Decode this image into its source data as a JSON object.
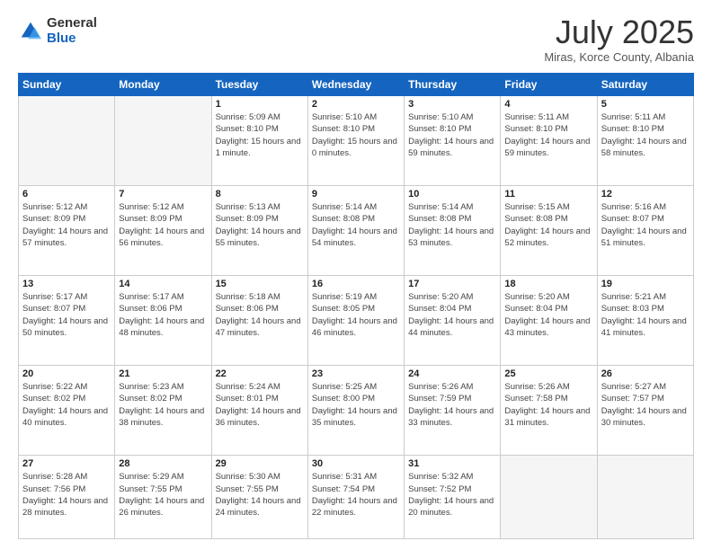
{
  "header": {
    "logo": {
      "general": "General",
      "blue": "Blue"
    },
    "title": "July 2025",
    "subtitle": "Miras, Korce County, Albania"
  },
  "weekdays": [
    "Sunday",
    "Monday",
    "Tuesday",
    "Wednesday",
    "Thursday",
    "Friday",
    "Saturday"
  ],
  "weeks": [
    [
      {
        "day": "",
        "info": ""
      },
      {
        "day": "",
        "info": ""
      },
      {
        "day": "1",
        "sunrise": "5:09 AM",
        "sunset": "8:10 PM",
        "daylight": "15 hours and 1 minute."
      },
      {
        "day": "2",
        "sunrise": "5:10 AM",
        "sunset": "8:10 PM",
        "daylight": "15 hours and 0 minutes."
      },
      {
        "day": "3",
        "sunrise": "5:10 AM",
        "sunset": "8:10 PM",
        "daylight": "14 hours and 59 minutes."
      },
      {
        "day": "4",
        "sunrise": "5:11 AM",
        "sunset": "8:10 PM",
        "daylight": "14 hours and 59 minutes."
      },
      {
        "day": "5",
        "sunrise": "5:11 AM",
        "sunset": "8:10 PM",
        "daylight": "14 hours and 58 minutes."
      }
    ],
    [
      {
        "day": "6",
        "sunrise": "5:12 AM",
        "sunset": "8:09 PM",
        "daylight": "14 hours and 57 minutes."
      },
      {
        "day": "7",
        "sunrise": "5:12 AM",
        "sunset": "8:09 PM",
        "daylight": "14 hours and 56 minutes."
      },
      {
        "day": "8",
        "sunrise": "5:13 AM",
        "sunset": "8:09 PM",
        "daylight": "14 hours and 55 minutes."
      },
      {
        "day": "9",
        "sunrise": "5:14 AM",
        "sunset": "8:08 PM",
        "daylight": "14 hours and 54 minutes."
      },
      {
        "day": "10",
        "sunrise": "5:14 AM",
        "sunset": "8:08 PM",
        "daylight": "14 hours and 53 minutes."
      },
      {
        "day": "11",
        "sunrise": "5:15 AM",
        "sunset": "8:08 PM",
        "daylight": "14 hours and 52 minutes."
      },
      {
        "day": "12",
        "sunrise": "5:16 AM",
        "sunset": "8:07 PM",
        "daylight": "14 hours and 51 minutes."
      }
    ],
    [
      {
        "day": "13",
        "sunrise": "5:17 AM",
        "sunset": "8:07 PM",
        "daylight": "14 hours and 50 minutes."
      },
      {
        "day": "14",
        "sunrise": "5:17 AM",
        "sunset": "8:06 PM",
        "daylight": "14 hours and 48 minutes."
      },
      {
        "day": "15",
        "sunrise": "5:18 AM",
        "sunset": "8:06 PM",
        "daylight": "14 hours and 47 minutes."
      },
      {
        "day": "16",
        "sunrise": "5:19 AM",
        "sunset": "8:05 PM",
        "daylight": "14 hours and 46 minutes."
      },
      {
        "day": "17",
        "sunrise": "5:20 AM",
        "sunset": "8:04 PM",
        "daylight": "14 hours and 44 minutes."
      },
      {
        "day": "18",
        "sunrise": "5:20 AM",
        "sunset": "8:04 PM",
        "daylight": "14 hours and 43 minutes."
      },
      {
        "day": "19",
        "sunrise": "5:21 AM",
        "sunset": "8:03 PM",
        "daylight": "14 hours and 41 minutes."
      }
    ],
    [
      {
        "day": "20",
        "sunrise": "5:22 AM",
        "sunset": "8:02 PM",
        "daylight": "14 hours and 40 minutes."
      },
      {
        "day": "21",
        "sunrise": "5:23 AM",
        "sunset": "8:02 PM",
        "daylight": "14 hours and 38 minutes."
      },
      {
        "day": "22",
        "sunrise": "5:24 AM",
        "sunset": "8:01 PM",
        "daylight": "14 hours and 36 minutes."
      },
      {
        "day": "23",
        "sunrise": "5:25 AM",
        "sunset": "8:00 PM",
        "daylight": "14 hours and 35 minutes."
      },
      {
        "day": "24",
        "sunrise": "5:26 AM",
        "sunset": "7:59 PM",
        "daylight": "14 hours and 33 minutes."
      },
      {
        "day": "25",
        "sunrise": "5:26 AM",
        "sunset": "7:58 PM",
        "daylight": "14 hours and 31 minutes."
      },
      {
        "day": "26",
        "sunrise": "5:27 AM",
        "sunset": "7:57 PM",
        "daylight": "14 hours and 30 minutes."
      }
    ],
    [
      {
        "day": "27",
        "sunrise": "5:28 AM",
        "sunset": "7:56 PM",
        "daylight": "14 hours and 28 minutes."
      },
      {
        "day": "28",
        "sunrise": "5:29 AM",
        "sunset": "7:55 PM",
        "daylight": "14 hours and 26 minutes."
      },
      {
        "day": "29",
        "sunrise": "5:30 AM",
        "sunset": "7:55 PM",
        "daylight": "14 hours and 24 minutes."
      },
      {
        "day": "30",
        "sunrise": "5:31 AM",
        "sunset": "7:54 PM",
        "daylight": "14 hours and 22 minutes."
      },
      {
        "day": "31",
        "sunrise": "5:32 AM",
        "sunset": "7:52 PM",
        "daylight": "14 hours and 20 minutes."
      },
      {
        "day": "",
        "info": ""
      },
      {
        "day": "",
        "info": ""
      }
    ]
  ]
}
